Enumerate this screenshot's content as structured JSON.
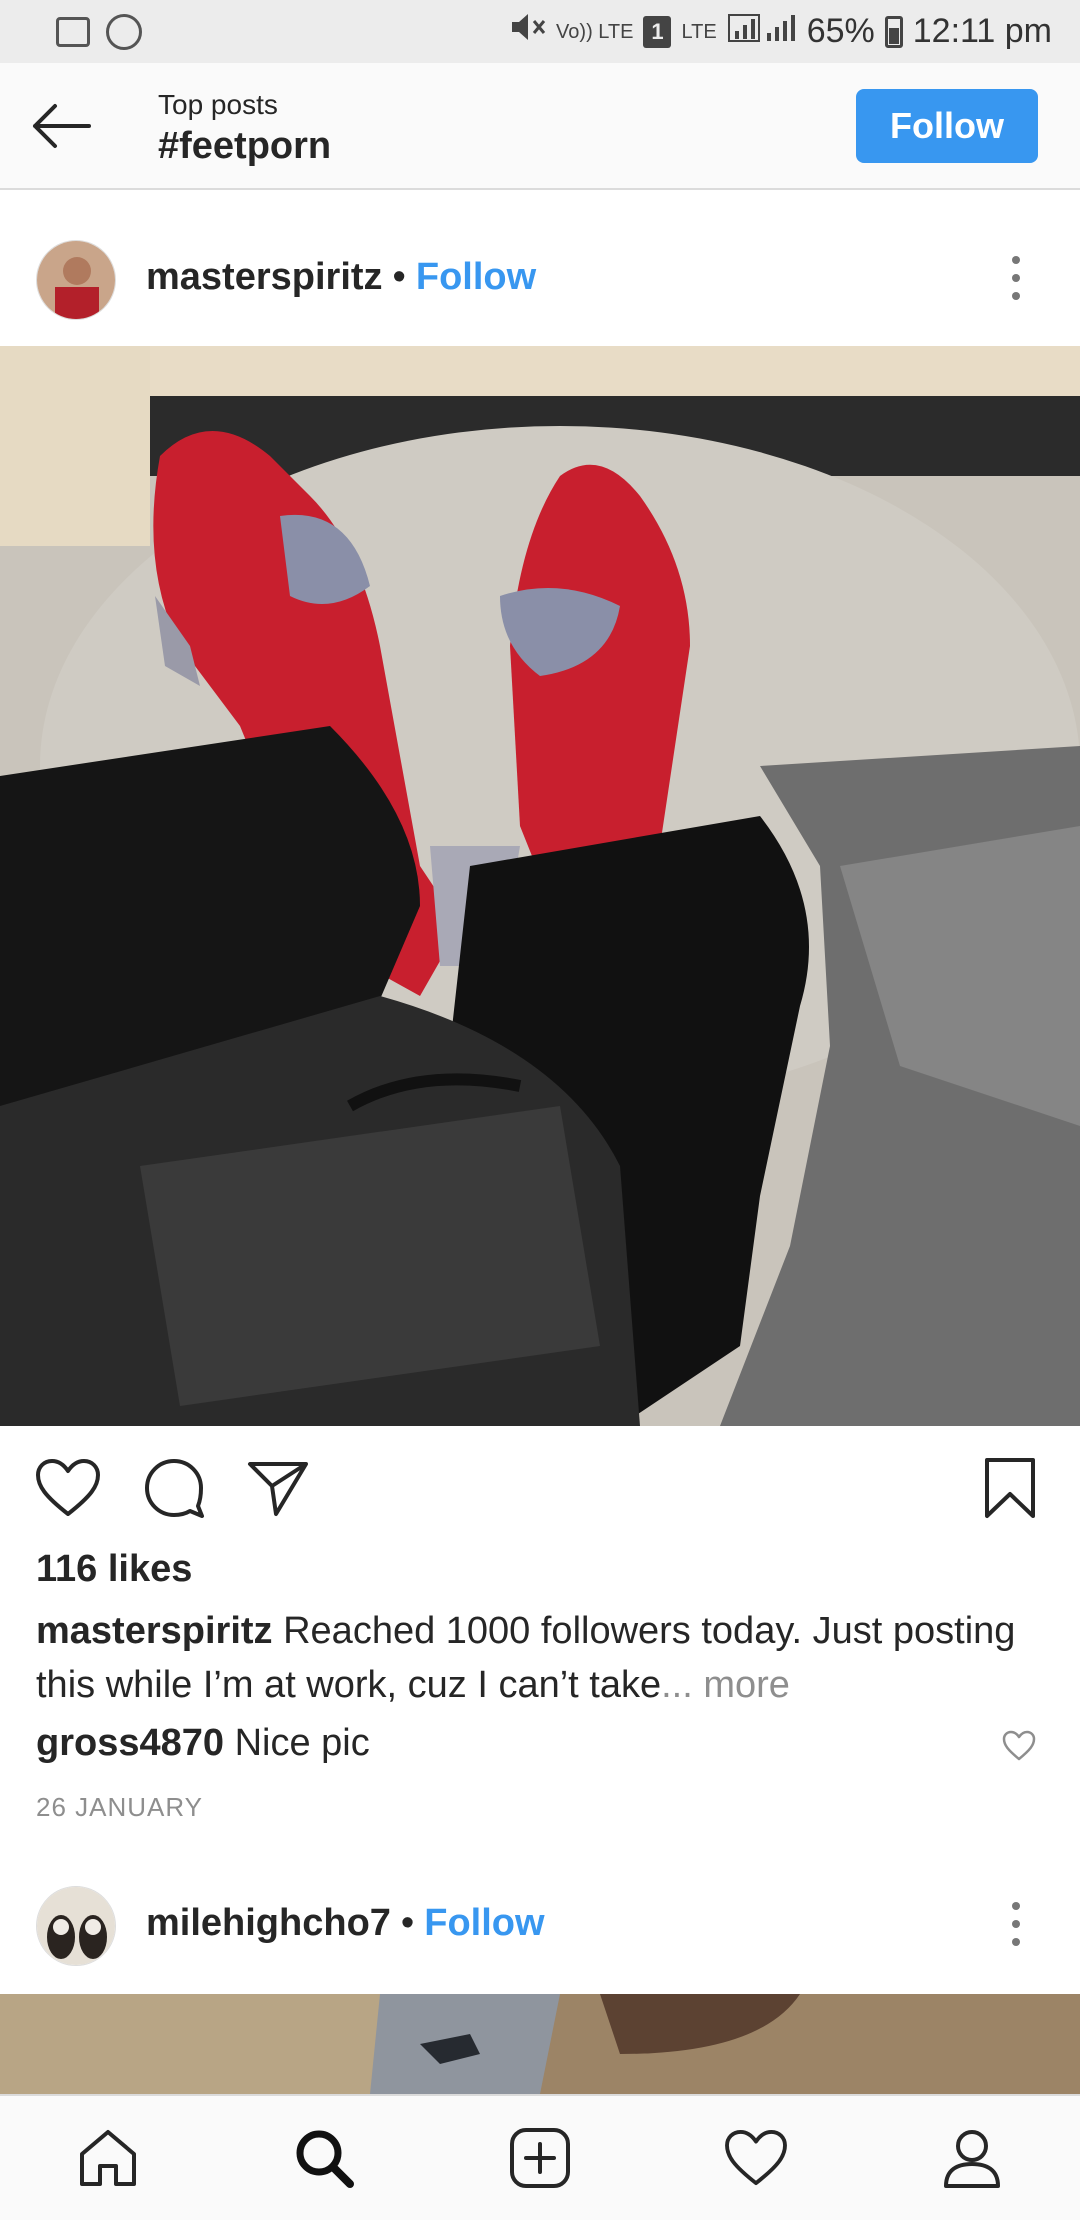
{
  "status_bar": {
    "volte_label": "Vo)) LTE",
    "sim_label": "1",
    "lte_label": "LTE",
    "battery": "65%",
    "time": "12:11 pm"
  },
  "header": {
    "subtitle": "Top posts",
    "title": "#feetporn",
    "follow_label": "Follow"
  },
  "post1": {
    "username": "masterspiritz",
    "separator": "•",
    "follow_label": "Follow",
    "likes": "116 likes",
    "caption_user": "masterspiritz",
    "caption_text": "Reached 1000 followers today. Just posting this while I’m at work, cuz I can’t take",
    "caption_more": "... more",
    "comment_user": "gross4870",
    "comment_text": "Nice pic",
    "date": "26 JANUARY"
  },
  "post2": {
    "username": "milehighcho7",
    "separator": "•",
    "follow_label": "Follow"
  },
  "colors": {
    "accent": "#3897f0",
    "text": "#262626",
    "muted": "#8e8e8e"
  }
}
